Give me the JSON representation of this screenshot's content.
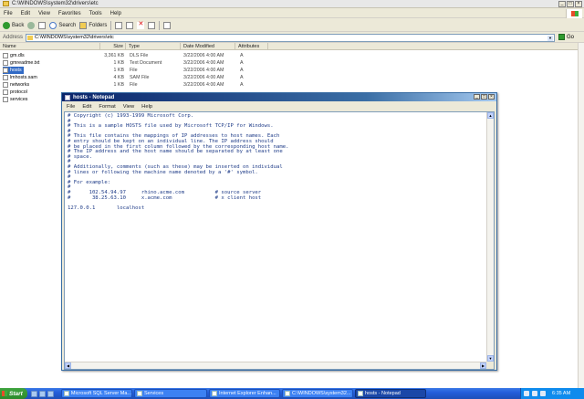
{
  "explorer": {
    "title": "C:\\WINDOWS\\system32\\drivers\\etc",
    "menu": [
      "File",
      "Edit",
      "View",
      "Favorites",
      "Tools",
      "Help"
    ],
    "toolbar": {
      "back": "Back",
      "search": "Search",
      "folders": "Folders"
    },
    "address_label": "Address",
    "address_value": "C:\\WINDOWS\\system32\\drivers\\etc",
    "go_label": "Go",
    "columns": [
      "Name",
      "Size",
      "Type",
      "Date Modified",
      "Attributes"
    ],
    "files": [
      {
        "name": "gm.dls",
        "size": "3,361 KB",
        "type": "DLS File",
        "date": "3/22/2006 4:00 AM",
        "attr": "A"
      },
      {
        "name": "gmreadme.txt",
        "size": "1 KB",
        "type": "Text Document",
        "date": "3/22/2006 4:00 AM",
        "attr": "A"
      },
      {
        "name": "hosts",
        "size": "1 KB",
        "type": "File",
        "date": "3/22/2006 4:00 AM",
        "attr": "A"
      },
      {
        "name": "lmhosts.sam",
        "size": "4 KB",
        "type": "SAM File",
        "date": "3/22/2006 4:00 AM",
        "attr": "A"
      },
      {
        "name": "networks",
        "size": "1 KB",
        "type": "File",
        "date": "3/22/2006 4:00 AM",
        "attr": "A"
      },
      {
        "name": "protocol",
        "size": "",
        "type": "",
        "date": "",
        "attr": ""
      },
      {
        "name": "services",
        "size": "",
        "type": "",
        "date": "",
        "attr": ""
      }
    ]
  },
  "notepad": {
    "title": "hosts - Notepad",
    "menu": [
      "File",
      "Edit",
      "Format",
      "View",
      "Help"
    ],
    "content": "# Copyright (c) 1993-1999 Microsoft Corp.\n#\n# This is a sample HOSTS file used by Microsoft TCP/IP for Windows.\n#\n# This file contains the mappings of IP addresses to host names. Each\n# entry should be kept on an individual line. The IP address should\n# be placed in the first column followed by the corresponding host name.\n# The IP address and the host name should be separated by at least one\n# space.\n#\n# Additionally, comments (such as these) may be inserted on individual\n# lines or following the machine name denoted by a '#' symbol.\n#\n# For example:\n#\n#      102.54.94.97     rhino.acme.com          # source server\n#       38.25.63.10     x.acme.com              # x client host\n\n127.0.0.1       localhost"
  },
  "taskbar": {
    "start": "Start",
    "tasks": [
      {
        "label": "Microsoft SQL Server Ma...",
        "active": false
      },
      {
        "label": "Services",
        "active": false
      },
      {
        "label": "Internet Explorer Enhan...",
        "active": false
      },
      {
        "label": "C:\\WINDOWS\\system32...",
        "active": false
      },
      {
        "label": "hosts - Notepad",
        "active": true
      }
    ],
    "clock": "6:35 AM"
  }
}
